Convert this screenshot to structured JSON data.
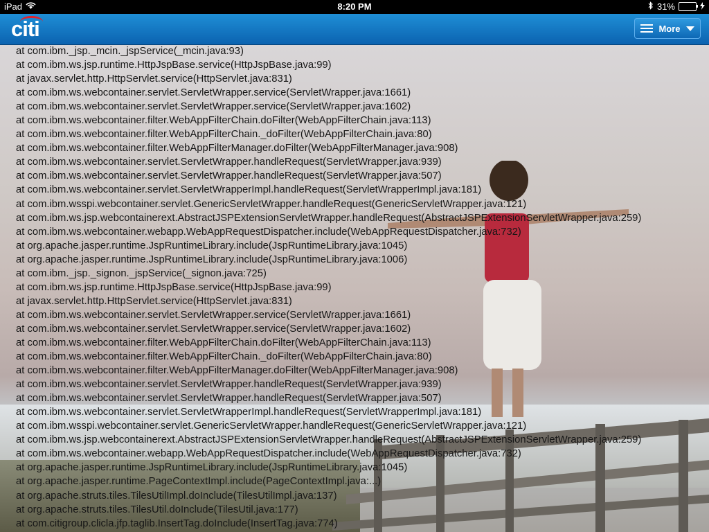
{
  "status_bar": {
    "device": "iPad",
    "time": "8:20 PM",
    "battery_percent": "31%",
    "battery_level": 0.31
  },
  "navbar": {
    "logo_text": "citi",
    "more_label": "More"
  },
  "trace_lines": [
    "at com.ibm._jsp._mcin._jspService(_mcin.java:93)",
    "at com.ibm.ws.jsp.runtime.HttpJspBase.service(HttpJspBase.java:99)",
    "at javax.servlet.http.HttpServlet.service(HttpServlet.java:831)",
    "at com.ibm.ws.webcontainer.servlet.ServletWrapper.service(ServletWrapper.java:1661)",
    "at com.ibm.ws.webcontainer.servlet.ServletWrapper.service(ServletWrapper.java:1602)",
    "at com.ibm.ws.webcontainer.filter.WebAppFilterChain.doFilter(WebAppFilterChain.java:113)",
    "at com.ibm.ws.webcontainer.filter.WebAppFilterChain._doFilter(WebAppFilterChain.java:80)",
    "at com.ibm.ws.webcontainer.filter.WebAppFilterManager.doFilter(WebAppFilterManager.java:908)",
    "at com.ibm.ws.webcontainer.servlet.ServletWrapper.handleRequest(ServletWrapper.java:939)",
    "at com.ibm.ws.webcontainer.servlet.ServletWrapper.handleRequest(ServletWrapper.java:507)",
    "at com.ibm.ws.webcontainer.servlet.ServletWrapperImpl.handleRequest(ServletWrapperImpl.java:181)",
    "at com.ibm.wsspi.webcontainer.servlet.GenericServletWrapper.handleRequest(GenericServletWrapper.java:121)",
    "at com.ibm.ws.jsp.webcontainerext.AbstractJSPExtensionServletWrapper.handleRequest(AbstractJSPExtensionServletWrapper.java:259)",
    "at com.ibm.ws.webcontainer.webapp.WebAppRequestDispatcher.include(WebAppRequestDispatcher.java:732)",
    "at org.apache.jasper.runtime.JspRuntimeLibrary.include(JspRuntimeLibrary.java:1045)",
    "at org.apache.jasper.runtime.JspRuntimeLibrary.include(JspRuntimeLibrary.java:1006)",
    "at com.ibm._jsp._signon._jspService(_signon.java:725)",
    "at com.ibm.ws.jsp.runtime.HttpJspBase.service(HttpJspBase.java:99)",
    "at javax.servlet.http.HttpServlet.service(HttpServlet.java:831)",
    "at com.ibm.ws.webcontainer.servlet.ServletWrapper.service(ServletWrapper.java:1661)",
    "at com.ibm.ws.webcontainer.servlet.ServletWrapper.service(ServletWrapper.java:1602)",
    "at com.ibm.ws.webcontainer.filter.WebAppFilterChain.doFilter(WebAppFilterChain.java:113)",
    "at com.ibm.ws.webcontainer.filter.WebAppFilterChain._doFilter(WebAppFilterChain.java:80)",
    "at com.ibm.ws.webcontainer.filter.WebAppFilterManager.doFilter(WebAppFilterManager.java:908)",
    "at com.ibm.ws.webcontainer.servlet.ServletWrapper.handleRequest(ServletWrapper.java:939)",
    "at com.ibm.ws.webcontainer.servlet.ServletWrapper.handleRequest(ServletWrapper.java:507)",
    "at com.ibm.ws.webcontainer.servlet.ServletWrapperImpl.handleRequest(ServletWrapperImpl.java:181)",
    "at com.ibm.wsspi.webcontainer.servlet.GenericServletWrapper.handleRequest(GenericServletWrapper.java:121)",
    "at com.ibm.ws.jsp.webcontainerext.AbstractJSPExtensionServletWrapper.handleRequest(AbstractJSPExtensionServletWrapper.java:259)",
    "at com.ibm.ws.webcontainer.webapp.WebAppRequestDispatcher.include(WebAppRequestDispatcher.java:732)",
    "at org.apache.jasper.runtime.JspRuntimeLibrary.include(JspRuntimeLibrary.java:1045)",
    "at org.apache.jasper.runtime.PageContextImpl.include(PageContextImpl.java:...)",
    "at org.apache.struts.tiles.TilesUtilImpl.doInclude(TilesUtilImpl.java:137)",
    "at org.apache.struts.tiles.TilesUtil.doInclude(TilesUtil.java:177)",
    "at com.citigroup.clicla.jfp.taglib.InsertTag.doInclude(InsertTag.java:774)"
  ],
  "colors": {
    "nav_top": "#1f8fd6",
    "nav_bottom": "#0b63b0",
    "logo_arc": "#e3202a",
    "trace_text": "#161616",
    "battery_fill": "#4cd964"
  }
}
